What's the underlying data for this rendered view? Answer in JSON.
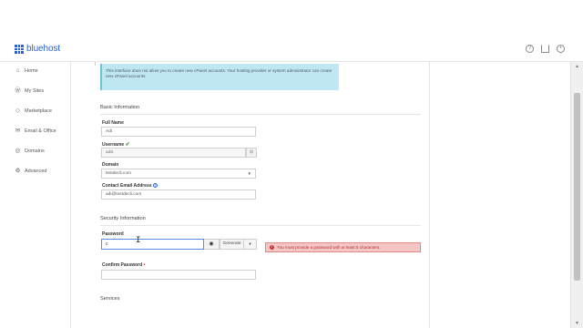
{
  "header": {
    "logo_text": "bluehost",
    "icons": [
      "help-icon",
      "cart-icon",
      "account-icon"
    ]
  },
  "sidebar": {
    "items": [
      {
        "label": "Home",
        "icon": "home-icon"
      },
      {
        "label": "My Sites",
        "icon": "wordpress-icon"
      },
      {
        "label": "Marketplace",
        "icon": "tag-icon"
      },
      {
        "label": "Email & Office",
        "icon": "mail-icon"
      },
      {
        "label": "Domains",
        "icon": "globe-icon"
      },
      {
        "label": "Advanced",
        "icon": "gear-icon"
      }
    ]
  },
  "notice": {
    "text": "This interface does not allow you to create new cPanel accounts. Your hosting provider or system administrator can create new cPanel accounts."
  },
  "basic": {
    "title": "Basic Information",
    "full_name_label": "Full Name",
    "full_name_value": "Adi",
    "username_label": "Username",
    "username_value": "adik",
    "domain_label": "Domain",
    "domain_value": "testdecli.com",
    "email_label": "Contact Email Address",
    "email_value": "adi@testdecli.com"
  },
  "security": {
    "title": "Security Information",
    "password_label": "Password",
    "password_value": "c",
    "generate_label": "Generate",
    "error_text": "You must provide a password with at least 5 characters.",
    "confirm_label": "Confirm Password",
    "confirm_required": "•"
  },
  "services": {
    "title": "Services"
  }
}
